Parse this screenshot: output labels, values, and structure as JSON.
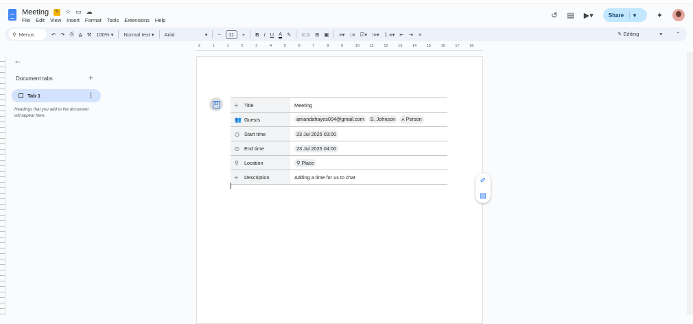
{
  "doc": {
    "title": "Meeting",
    "menu": [
      "File",
      "Edit",
      "View",
      "Insert",
      "Format",
      "Tools",
      "Extensions",
      "Help"
    ]
  },
  "header": {
    "share_label": "Share"
  },
  "toolbar": {
    "menus_label": "Menus",
    "zoom": "100%",
    "style": "Normal text",
    "font": "Arial",
    "font_size": "11",
    "mode": "Editing"
  },
  "ruler": [
    "2",
    "1",
    "1",
    "2",
    "3",
    "4",
    "5",
    "6",
    "7",
    "8",
    "9",
    "10",
    "11",
    "12",
    "13",
    "14",
    "15",
    "16",
    "17",
    "18"
  ],
  "sidebar": {
    "heading": "Document tabs",
    "tab_label": "Tab 1",
    "hint": "Headings that you add to the document will appear here."
  },
  "event": {
    "rows": [
      {
        "icon": "title-icon",
        "glyph": "≡",
        "label": "Title",
        "text": "Meeting",
        "chips": []
      },
      {
        "icon": "guests-icon",
        "glyph": "👥",
        "label": "Guests",
        "text": "",
        "chips": [
          "amandahayes004@gmail.com",
          "S. Johnson",
          "⍲ Person"
        ]
      },
      {
        "icon": "clock-icon",
        "glyph": "◷",
        "label": "Start time",
        "text": "",
        "chips": [
          "23 Jul 2025 03:00"
        ]
      },
      {
        "icon": "clock-end-icon",
        "glyph": "◴",
        "label": "End time",
        "text": "",
        "chips": [
          "23 Jul 2025 04:00"
        ]
      },
      {
        "icon": "location-icon",
        "glyph": "⚲",
        "label": "Location",
        "text": "",
        "chips": [
          "⚲ Place"
        ]
      },
      {
        "icon": "description-icon",
        "glyph": "≡",
        "label": "Description",
        "text": "Adding a time for us to chat",
        "chips": []
      }
    ],
    "calendar_day": "31"
  }
}
